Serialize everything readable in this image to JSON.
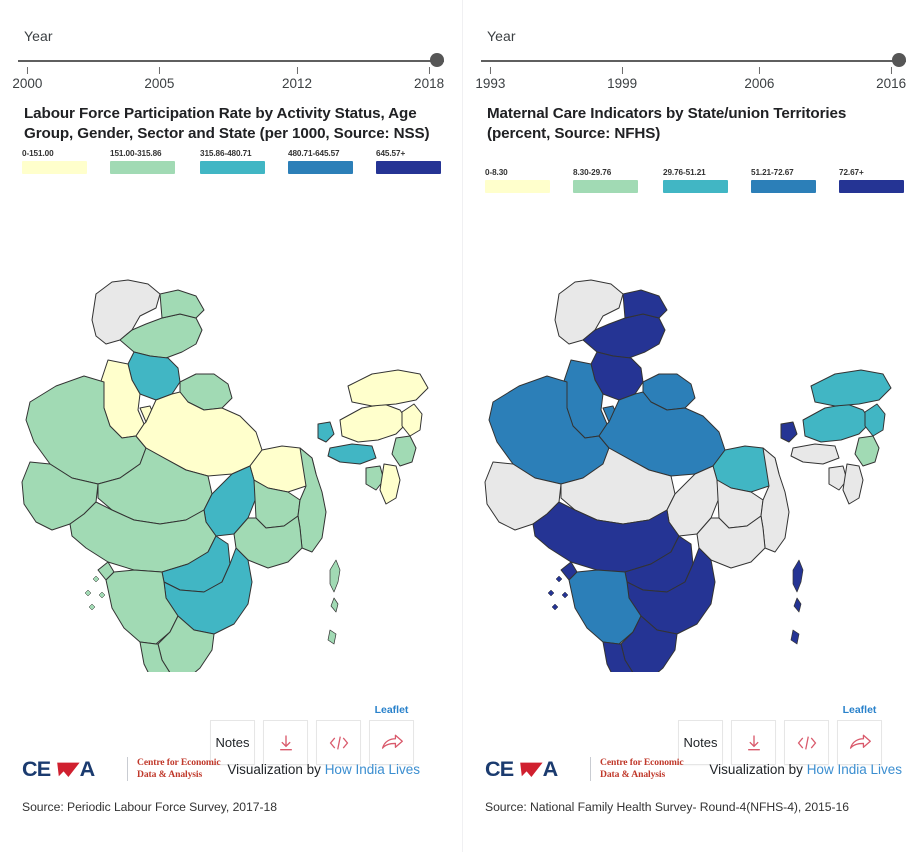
{
  "panels": [
    {
      "slider": {
        "label": "Year",
        "ticks": [
          "2000",
          "2005",
          "2012",
          "2018"
        ],
        "selected": "2018"
      },
      "title": "Labour Force Participation Rate by Activity Status, Age Group, Gender, Sector and State (per 1000, Source: NSS)",
      "legend": [
        {
          "label": "0-151.00",
          "color": "#ffffcc"
        },
        {
          "label": "151.00-315.86",
          "color": "#a1dab4"
        },
        {
          "label": "315.86-480.71",
          "color": "#41b6c4"
        },
        {
          "label": "480.71-645.57",
          "color": "#2c7fb8"
        },
        {
          "label": "645.57+",
          "color": "#253494"
        }
      ],
      "toolbar": {
        "notes_label": "Notes",
        "download_icon": "download-icon",
        "embed_icon": "code-embed-icon",
        "share_icon": "share-arrow-icon",
        "leaflet_label": "Leaflet"
      },
      "attribution": {
        "prefix": "Visualization by ",
        "link": "How India Lives"
      },
      "logo": {
        "mark": "CEDA",
        "line1": "Centre for Economic",
        "line2": "Data & Analysis"
      },
      "source": "Source: Periodic Labour Force Survey, 2017-18"
    },
    {
      "slider": {
        "label": "Year",
        "ticks": [
          "1993",
          "1999",
          "2006",
          "2016"
        ],
        "selected": "2016"
      },
      "title": "Maternal Care Indicators by State/union Territories (percent, Source: NFHS)",
      "legend": [
        {
          "label": "0-8.30",
          "color": "#ffffcc"
        },
        {
          "label": "8.30-29.76",
          "color": "#a1dab4"
        },
        {
          "label": "29.76-51.21",
          "color": "#41b6c4"
        },
        {
          "label": "51.21-72.67",
          "color": "#2c7fb8"
        },
        {
          "label": "72.67+",
          "color": "#253494"
        }
      ],
      "toolbar": {
        "notes_label": "Notes",
        "download_icon": "download-icon",
        "embed_icon": "code-embed-icon",
        "share_icon": "share-arrow-icon",
        "leaflet_label": "Leaflet"
      },
      "attribution": {
        "prefix": "Visualization by ",
        "link": "How India Lives"
      },
      "logo": {
        "mark": "CEDA",
        "line1": "Centre for Economic",
        "line2": "Data & Analysis"
      },
      "source": "Source: National Family Health Survey- Round-4(NFHS-4), 2015-16"
    }
  ],
  "map_regions_left": {
    "Jammu & Kashmir": "#e8e8e8",
    "Himachal Pradesh": "#a1dab4",
    "Punjab": "#41b6c4",
    "Uttarakhand": "#a1dab4",
    "Haryana": "#ffffcc",
    "Rajasthan": "#a1dab4",
    "Uttar Pradesh": "#ffffcc",
    "Bihar": "#ffffcc",
    "Gujarat": "#a1dab4",
    "Madhya Pradesh": "#a1dab4",
    "Jharkhand": "#a1dab4",
    "West Bengal": "#a1dab4",
    "Sikkim": "#41b6c4",
    "Assam": "#ffffcc",
    "Meghalaya": "#41b6c4",
    "Tripura": "#a1dab4",
    "Mizoram": "#ffffcc",
    "Manipur": "#a1dab4",
    "Nagaland": "#ffffcc",
    "Arunachal Pradesh": "#ffffcc",
    "Odisha": "#a1dab4",
    "Chhattisgarh": "#41b6c4",
    "Maharashtra": "#a1dab4",
    "Telangana": "#41b6c4",
    "Andhra Pradesh": "#41b6c4",
    "Karnataka": "#a1dab4",
    "Tamil Nadu": "#a1dab4",
    "Kerala": "#a1dab4",
    "Goa": "#a1dab4",
    "Andaman & Nicobar": "#a1dab4"
  },
  "map_regions_right": {
    "Jammu & Kashmir": "#e8e8e8",
    "Himachal Pradesh": "#253494",
    "Punjab": "#253494",
    "Uttarakhand": "#253494",
    "Haryana": "#2c7fb8",
    "Rajasthan": "#2c7fb8",
    "Uttar Pradesh": "#2c7fb8",
    "Bihar": "#41b6c4",
    "Gujarat": "#e8e8e8",
    "Madhya Pradesh": "#e8e8e8",
    "Jharkhand": "#e8e8e8",
    "West Bengal": "#e8e8e8",
    "Sikkim": "#253494",
    "Assam": "#41b6c4",
    "Meghalaya": "#e8e8e8",
    "Tripura": "#e8e8e8",
    "Mizoram": "#e8e8e8",
    "Manipur": "#a1dab4",
    "Nagaland": "#41b6c4",
    "Arunachal Pradesh": "#41b6c4",
    "Odisha": "#e8e8e8",
    "Chhattisgarh": "#e8e8e8",
    "Maharashtra": "#253494",
    "Telangana": "#253494",
    "Andhra Pradesh": "#253494",
    "Karnataka": "#2c7fb8",
    "Tamil Nadu": "#253494",
    "Kerala": "#253494",
    "Goa": "#253494",
    "Andaman & Nicobar": "#253494"
  }
}
